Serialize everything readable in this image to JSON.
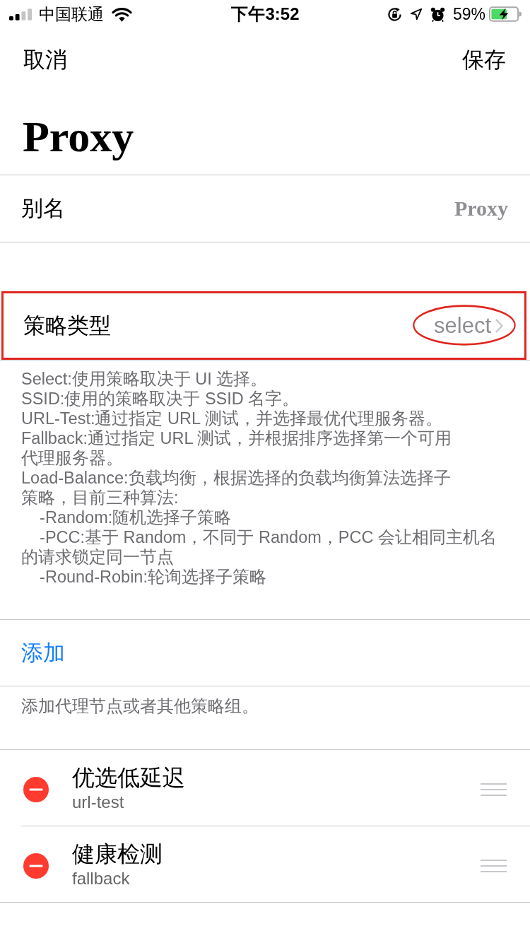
{
  "status_bar": {
    "carrier": "中国联通",
    "time": "下午3:52",
    "battery": "59%"
  },
  "nav": {
    "cancel": "取消",
    "save": "保存"
  },
  "title": "Proxy",
  "alias": {
    "label": "别名",
    "value": "Proxy"
  },
  "policy_type": {
    "label": "策略类型",
    "value": "select",
    "highlighted": true,
    "value_circled": true,
    "description": [
      "Select:使用策略取决于 UI 选择。",
      "SSID:使用的策略取决于 SSID 名字。",
      "URL-Test:通过指定 URL 测试，并选择最优代理服务器。",
      "Fallback:通过指定 URL 测试，并根据排序选择第一个可用",
      "代理服务器。",
      "Load-Balance:负载均衡，根据选择的负载均衡算法选择子",
      "策略，目前三种算法:",
      "    -Random:随机选择子策略",
      "    -PCC:基于 Random，不同于 Random，PCC 会让相同主机名",
      "的请求锁定同一节点",
      "    -Round-Robin:轮询选择子策略"
    ]
  },
  "add": {
    "label": "添加",
    "hint": "添加代理节点或者其他策略组。"
  },
  "members": [
    {
      "name": "优选低延迟",
      "type": "url-test"
    },
    {
      "name": "健康检测",
      "type": "fallback"
    }
  ]
}
